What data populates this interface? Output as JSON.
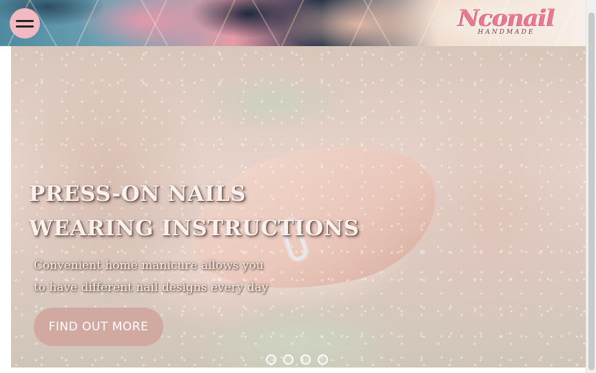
{
  "header": {
    "menu_icon": "hamburger-menu-icon",
    "logo": {
      "word": "Nconail",
      "sub": "HANDMADE",
      "color": "#e8798e"
    }
  },
  "hero": {
    "title_lines": [
      "PRESS-ON NAILS",
      "WEARING INSTRUCTIONS"
    ],
    "subtitle_lines": [
      "Convenient home manicure allows you",
      "to have different nail designs every day"
    ],
    "cta_label": "FIND OUT MORE",
    "cta_color": "#d2a9a1",
    "slide_count": 4
  }
}
